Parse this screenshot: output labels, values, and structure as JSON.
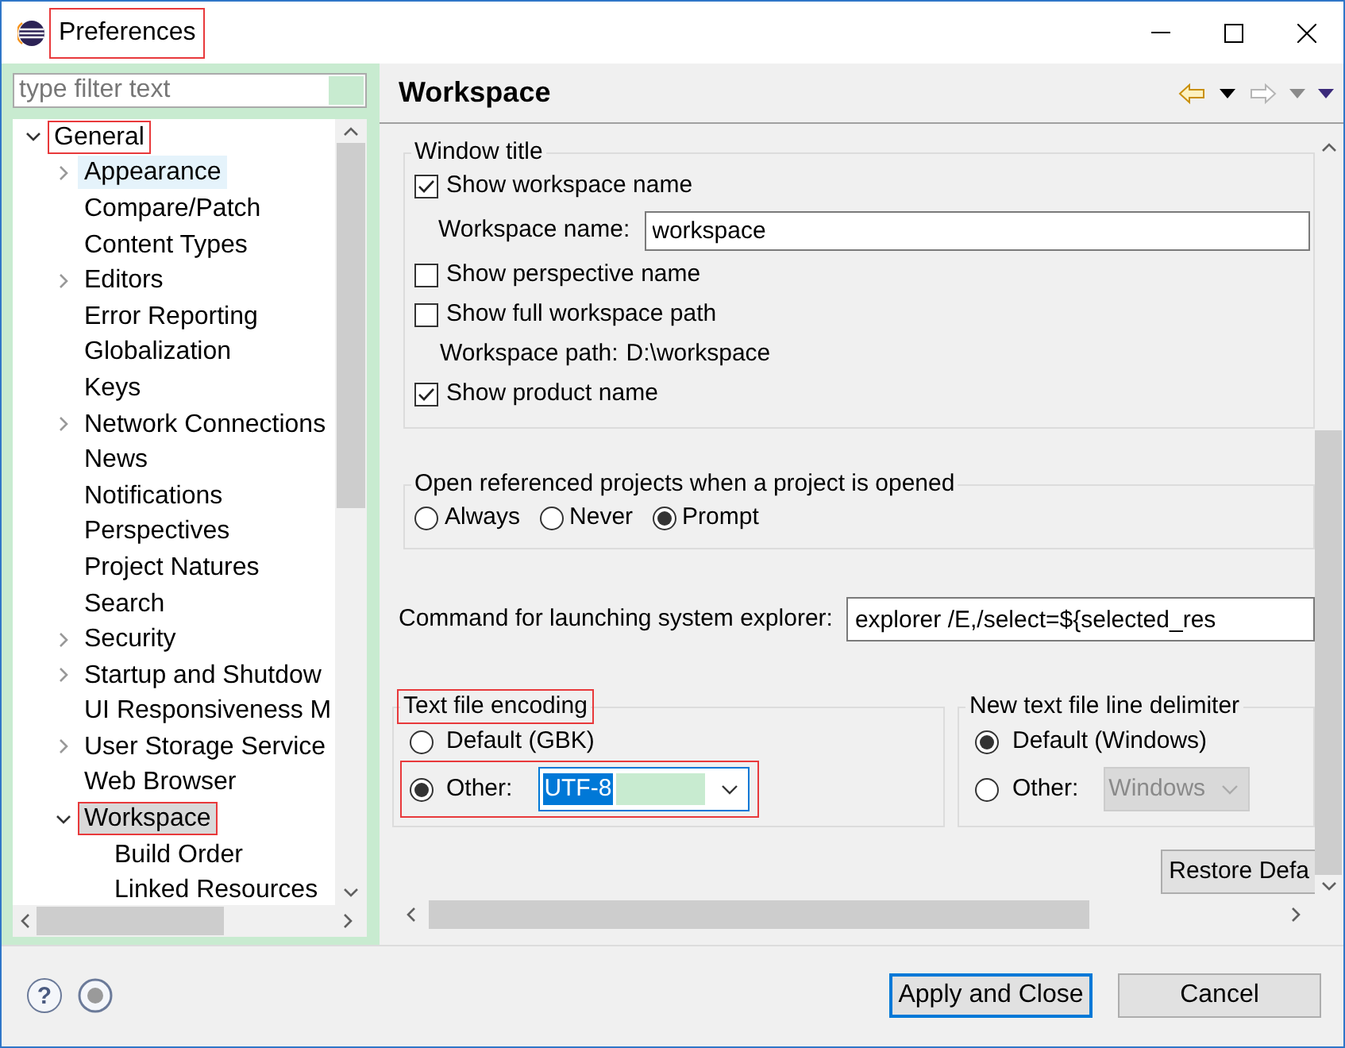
{
  "window": {
    "title": "Preferences",
    "annotated": true
  },
  "filter": {
    "placeholder": "type filter text"
  },
  "tree": [
    {
      "label": "General",
      "expandable": true,
      "expanded": true,
      "selected": false,
      "hovered": false,
      "annotated": true,
      "children": [
        {
          "label": "Appearance",
          "expandable": true,
          "expanded": false,
          "selected": false,
          "hovered": true
        },
        {
          "label": "Compare/Patch",
          "expandable": false,
          "selected": false,
          "hovered": false
        },
        {
          "label": "Content Types",
          "expandable": false,
          "selected": false,
          "hovered": false
        },
        {
          "label": "Editors",
          "expandable": true,
          "expanded": false,
          "selected": false,
          "hovered": false
        },
        {
          "label": "Error Reporting",
          "expandable": false,
          "selected": false,
          "hovered": false
        },
        {
          "label": "Globalization",
          "expandable": false,
          "selected": false,
          "hovered": false
        },
        {
          "label": "Keys",
          "expandable": false,
          "selected": false,
          "hovered": false
        },
        {
          "label": "Network Connections",
          "expandable": true,
          "expanded": false,
          "selected": false,
          "hovered": false
        },
        {
          "label": "News",
          "expandable": false,
          "selected": false,
          "hovered": false
        },
        {
          "label": "Notifications",
          "expandable": false,
          "selected": false,
          "hovered": false
        },
        {
          "label": "Perspectives",
          "expandable": false,
          "selected": false,
          "hovered": false
        },
        {
          "label": "Project Natures",
          "expandable": false,
          "selected": false,
          "hovered": false
        },
        {
          "label": "Search",
          "expandable": false,
          "selected": false,
          "hovered": false
        },
        {
          "label": "Security",
          "expandable": true,
          "expanded": false,
          "selected": false,
          "hovered": false
        },
        {
          "label": "Startup and Shutdow",
          "expandable": true,
          "expanded": false,
          "selected": false,
          "hovered": false
        },
        {
          "label": "UI Responsiveness M",
          "expandable": false,
          "selected": false,
          "hovered": false
        },
        {
          "label": "User Storage Service",
          "expandable": true,
          "expanded": false,
          "selected": false,
          "hovered": false
        },
        {
          "label": "Web Browser",
          "expandable": false,
          "selected": false,
          "hovered": false
        },
        {
          "label": "Workspace",
          "expandable": true,
          "expanded": true,
          "selected": true,
          "hovered": false,
          "annotated": true,
          "children": [
            {
              "label": "Build Order",
              "expandable": false,
              "selected": false,
              "hovered": false
            },
            {
              "label": "Linked Resources",
              "expandable": false,
              "selected": false,
              "hovered": false
            }
          ]
        }
      ]
    }
  ],
  "page": {
    "title": "Workspace"
  },
  "window_title_group": {
    "legend": "Window title",
    "items": [
      {
        "kind": "checkbox",
        "label": "Show workspace name",
        "checked": true
      },
      {
        "kind": "field",
        "label": "Workspace name:",
        "value": "workspace"
      },
      {
        "kind": "checkbox",
        "label": "Show perspective name",
        "checked": false
      },
      {
        "kind": "checkbox",
        "label": "Show full workspace path",
        "checked": false
      },
      {
        "kind": "info",
        "label": "Workspace path:",
        "value": "D:\\workspace"
      },
      {
        "kind": "checkbox",
        "label": "Show product name",
        "checked": true
      }
    ]
  },
  "open_projects_group": {
    "legend": "Open referenced projects when a project is opened",
    "options": [
      {
        "label": "Always",
        "selected": false
      },
      {
        "label": "Never",
        "selected": false
      },
      {
        "label": "Prompt",
        "selected": true
      }
    ]
  },
  "explorer_command": {
    "label": "Command for launching system explorer:",
    "value": "explorer /E,/select=${selected_res"
  },
  "encoding_group": {
    "legend": "Text file encoding",
    "annotated": true,
    "options": [
      {
        "label": "Default (GBK)",
        "selected": false
      },
      {
        "label": "Other:",
        "selected": true,
        "annotated": true
      }
    ],
    "combo": {
      "value": "UTF-8",
      "disabled": false
    }
  },
  "delimiter_group": {
    "legend": "New text file line delimiter",
    "options": [
      {
        "label": "Default (Windows)",
        "selected": true
      },
      {
        "label": "Other:",
        "selected": false
      }
    ],
    "combo": {
      "value": "Windows",
      "disabled": true
    }
  },
  "restore_button": "Restore Defa",
  "help": "?",
  "buttons": [
    {
      "label": "Apply and Close",
      "default": true
    },
    {
      "label": "Cancel",
      "default": false
    }
  ]
}
